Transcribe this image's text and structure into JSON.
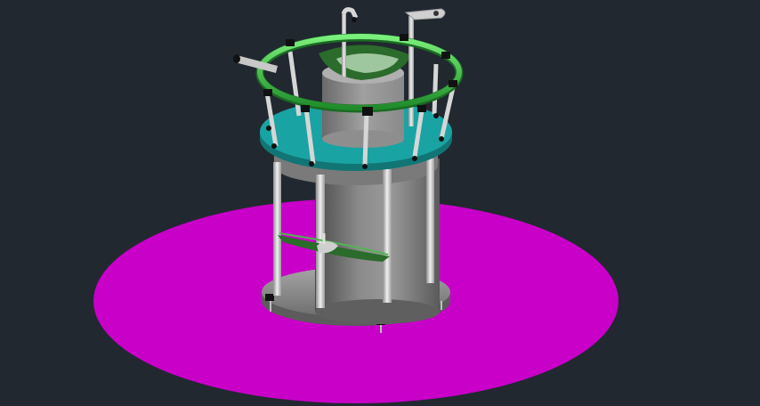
{
  "viewport": {
    "background": "#212830",
    "render_style": "shaded-3d"
  },
  "model": {
    "ground_disk_color": "#c800c8",
    "base_plate_color": "#8f8f8f",
    "cylinder_color": "#7a7a7a",
    "top_plate_color": "#1aa3a3",
    "ring_color": "#2ea83a",
    "green_panel_color": "#2b6b2b",
    "rod_color": "#d6d6d6",
    "fitting_color": "#101010"
  }
}
